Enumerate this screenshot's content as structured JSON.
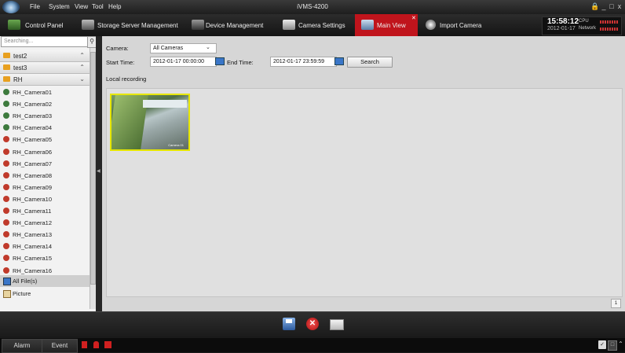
{
  "window": {
    "title": "iVMS-4200",
    "menu": [
      "File",
      "System",
      "View",
      "Tool",
      "Help"
    ],
    "controls": {
      "lock": "🔒",
      "minimize": "_",
      "maximize": "□",
      "close": "x"
    }
  },
  "tabs": [
    {
      "label": "Control Panel",
      "icon": "control-panel-icon",
      "active": false
    },
    {
      "label": "Storage Server Management",
      "icon": "storage-server-icon",
      "active": false
    },
    {
      "label": "Device Management",
      "icon": "device-management-icon",
      "active": false
    },
    {
      "label": "Camera Settings",
      "icon": "camera-settings-icon",
      "active": false
    },
    {
      "label": "Main View",
      "icon": "monitor-icon",
      "active": true
    },
    {
      "label": "Import Camera",
      "icon": "import-camera-icon",
      "active": false
    }
  ],
  "status_clock": {
    "time": "15:58:12",
    "date": "2012-01-17",
    "cpu_label": "CPU",
    "network_label": "Network"
  },
  "sidebar": {
    "search_placeholder": "Searching...",
    "groups": [
      {
        "label": "test2",
        "expanded": false
      },
      {
        "label": "test3",
        "expanded": false
      },
      {
        "label": "RH",
        "expanded": true
      }
    ],
    "cameras": [
      {
        "label": "RH_Camera01",
        "online": true
      },
      {
        "label": "RH_Camera02",
        "online": true
      },
      {
        "label": "RH_Camera03",
        "online": true
      },
      {
        "label": "RH_Camera04",
        "online": true
      },
      {
        "label": "RH_Camera05",
        "online": false
      },
      {
        "label": "RH_Camera06",
        "online": false
      },
      {
        "label": "RH_Camera07",
        "online": false
      },
      {
        "label": "RH_Camera08",
        "online": false
      },
      {
        "label": "RH_Camera09",
        "online": false
      },
      {
        "label": "RH_Camera10",
        "online": false
      },
      {
        "label": "RH_Camera11",
        "online": false
      },
      {
        "label": "RH_Camera12",
        "online": false
      },
      {
        "label": "RH_Camera13",
        "online": false
      },
      {
        "label": "RH_Camera14",
        "online": false
      },
      {
        "label": "RH_Camera15",
        "online": false
      },
      {
        "label": "RH_Camera16",
        "online": false
      }
    ],
    "file_types": [
      {
        "label": "All File(s)",
        "selected": true
      },
      {
        "label": "Picture",
        "selected": false
      }
    ]
  },
  "filters": {
    "camera_label": "Camera:",
    "camera_value": "All Cameras",
    "start_label": "Start Time:",
    "start_value": "2012-01-17 00:00:00",
    "end_label": "End Time:",
    "end_value": "2012-01-17 23:59:59",
    "search_button": "Search",
    "section_title": "Local recording"
  },
  "results": {
    "thumbnails": [
      {
        "caption": "Camera 01"
      }
    ],
    "page": "1"
  },
  "toolbar": {
    "buttons": [
      "save-icon",
      "delete-icon",
      "email-icon"
    ]
  },
  "statusbar": {
    "tabs": [
      "Alarm",
      "Event"
    ],
    "right_icons": [
      "pin-icon",
      "restore-icon",
      "collapse-icon"
    ]
  },
  "colors": {
    "active_tab": "#c0141c",
    "selection_border": "#e6e600",
    "online": "#3d7a3d",
    "offline": "#c03a2b"
  }
}
